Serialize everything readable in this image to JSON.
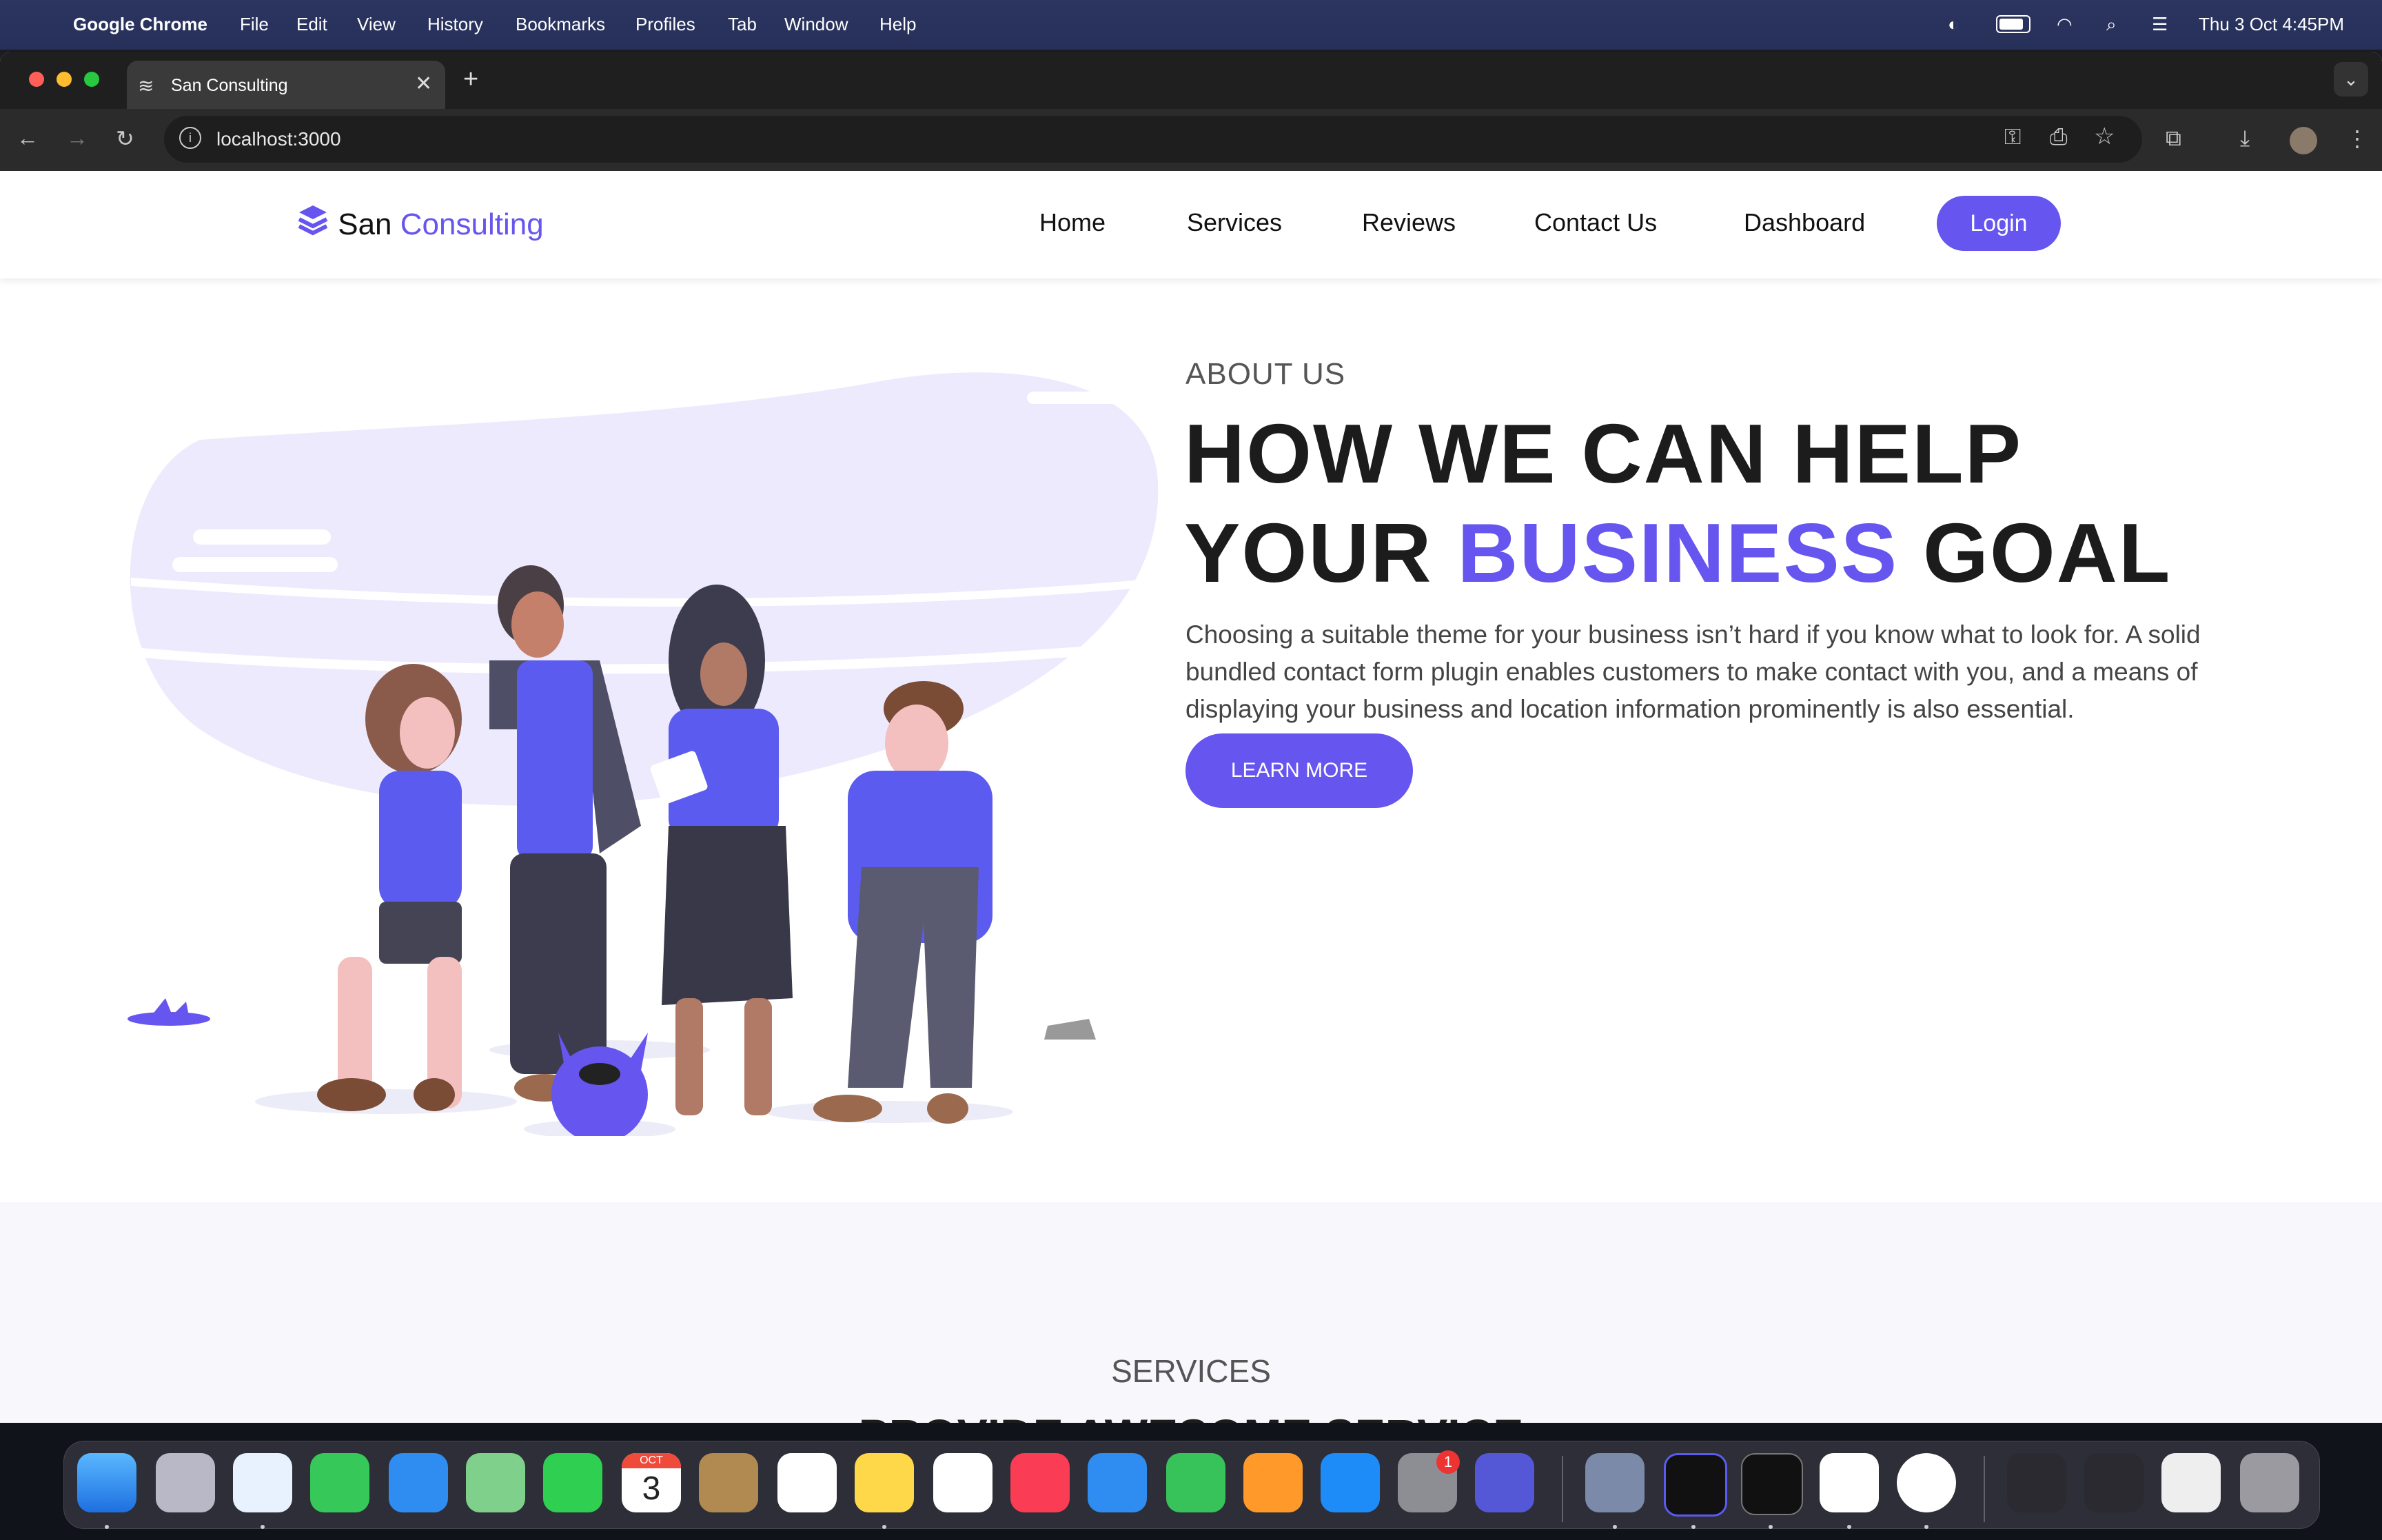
{
  "menubar": {
    "app_name": "Google Chrome",
    "menus": [
      "File",
      "Edit",
      "View",
      "History",
      "Bookmarks",
      "Profiles",
      "Tab",
      "Window",
      "Help"
    ],
    "clock": "Thu 3 Oct  4:45PM"
  },
  "browser": {
    "tab_title": "San Consulting",
    "url": "localhost:3000",
    "new_tab_symbol": "+"
  },
  "site": {
    "brand": {
      "first": "San",
      "second": "Consulting"
    },
    "nav": [
      "Home",
      "Services",
      "Reviews",
      "Contact Us",
      "Dashboard"
    ],
    "login_label": "Login"
  },
  "hero": {
    "eyebrow": "ABOUT US",
    "line1": "HOW WE CAN HELP",
    "line2_start": "YOUR",
    "line2_accent": "BUSINESS",
    "line2_end": "GOAL",
    "paragraph": "Choosing a suitable theme for your business isn’t hard if you know what to look for. A solid bundled contact form plugin enables customers to make contact with you, and a means of displaying your business and location information prominently is also essential.",
    "cta": "LEARN MORE"
  },
  "services": {
    "eyebrow": "SERVICES",
    "title": "PROVIDE AWESOME SERVICE"
  },
  "dock": {
    "calendar_month": "OCT",
    "calendar_day": "3",
    "settings_badge": "1"
  },
  "colors": {
    "accent": "#6655EE",
    "text": "#1C1C1C"
  }
}
